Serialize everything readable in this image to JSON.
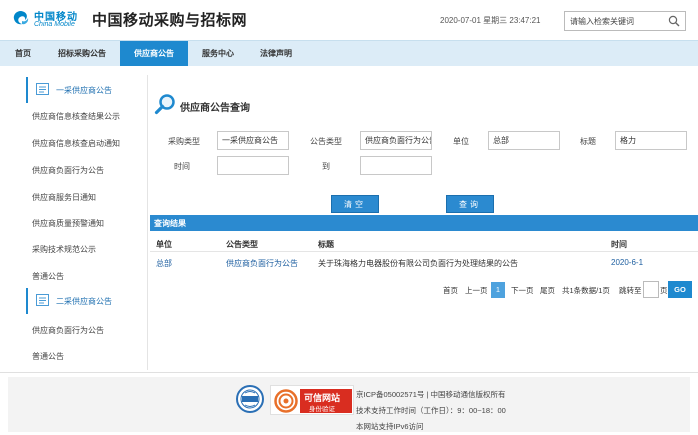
{
  "header": {
    "logo_cn": "中国移动",
    "logo_en": "China Mobile",
    "site_title": "中国移动采购与招标网",
    "datetime": "2020-07-01 星期三 23:47:21",
    "search_placeholder": "请输入检索关键词"
  },
  "nav": [
    "首页",
    "招标采购公告",
    "供应商公告",
    "服务中心",
    "法律声明"
  ],
  "nav_active": "供应商公告",
  "sidebar": {
    "group1": "一采供应商公告",
    "group1_items": [
      "供应商信息核查结果公示",
      "供应商信息核查启动通知",
      "供应商负面行为公告",
      "供应商服务日通知",
      "供应商质量预警通知",
      "采购技术规范公示",
      "普通公告"
    ],
    "group2": "二采供应商公告",
    "group2_items": [
      "供应商负面行为公告",
      "普通公告"
    ]
  },
  "query": {
    "title": "供应商公告查询",
    "labels": {
      "type": "采购类型",
      "notice_type": "公告类型",
      "unit": "单位",
      "subject": "标题",
      "time": "时间",
      "to": "到"
    },
    "values": {
      "type": "一采供应商公告",
      "notice_type": "供应商负面行为公告",
      "unit": "总部",
      "subject": "格力",
      "time_from": "",
      "time_to": ""
    },
    "clear_label": "清空",
    "search_label": "查询"
  },
  "results": {
    "title": "查询结果",
    "headers": {
      "unit": "单位",
      "type": "公告类型",
      "subject": "标题",
      "time": "时间"
    },
    "rows": [
      {
        "unit": "总部",
        "type": "供应商负面行为公告",
        "subject": "关于珠海格力电器股份有限公司负面行为处理结果的公告",
        "time": "2020-6-1"
      }
    ]
  },
  "pager": {
    "first": "首页",
    "prev": "上一页",
    "current": "1",
    "next": "下一页",
    "last": "尾页",
    "summary": "共1条数据/1页",
    "jump_label": "跳转至",
    "page_unit": "页",
    "go": "GO"
  },
  "footer": {
    "icp": "京ICP备05002571号 | 中国移动通信版权所有",
    "support_hours": "技术支持工作时间（工作日）：9：00~18：00",
    "ipv6": "本网站支持IPv6访问",
    "badge_text": "可信网站",
    "badge_sub": "身份验证"
  },
  "colors": {
    "brand_blue": "#1e89cf",
    "nav_bg": "#dcecf7",
    "badge_red": "#d92d20"
  }
}
